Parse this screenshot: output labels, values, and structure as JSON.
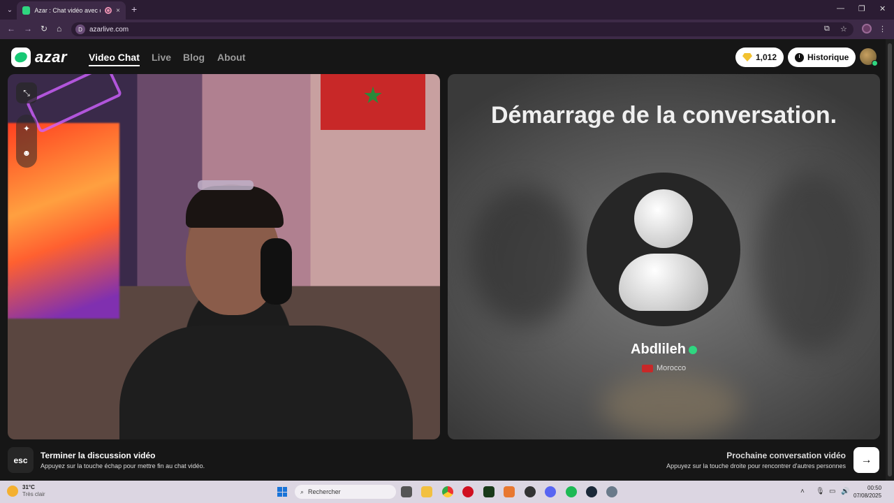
{
  "browser": {
    "tab_title": "Azar : Chat vidéo avec de n",
    "tab_close": "×",
    "new_tab": "+",
    "url": "azarlive.com",
    "url_icon": "D"
  },
  "header": {
    "logo_text": "azar",
    "nav": [
      "Video Chat",
      "Live",
      "Blog",
      "About"
    ],
    "gems": "1,012",
    "history_label": "Historique"
  },
  "conversation": {
    "title": "Démarrage de la conversation.",
    "user_name": "Abdlileh",
    "country": "Morocco"
  },
  "footer": {
    "esc_key": "esc",
    "end_title": "Terminer la discussion vidéo",
    "end_sub": "Appuyez sur la touche échap pour mettre fin au chat vidéo.",
    "next_title": "Prochaine conversation vidéo",
    "next_sub": "Appuyez sur la touche droite pour rencontrer d'autres personnes",
    "next_arrow": "→"
  },
  "taskbar": {
    "temp": "31°C",
    "weather": "Très clair",
    "search_placeholder": "Rechercher",
    "time": "00:50",
    "date": "07/08/2025"
  },
  "colors": {
    "accent_green": "#2fd680",
    "browser_frame": "#2b1c33",
    "page_bg": "#161616"
  }
}
